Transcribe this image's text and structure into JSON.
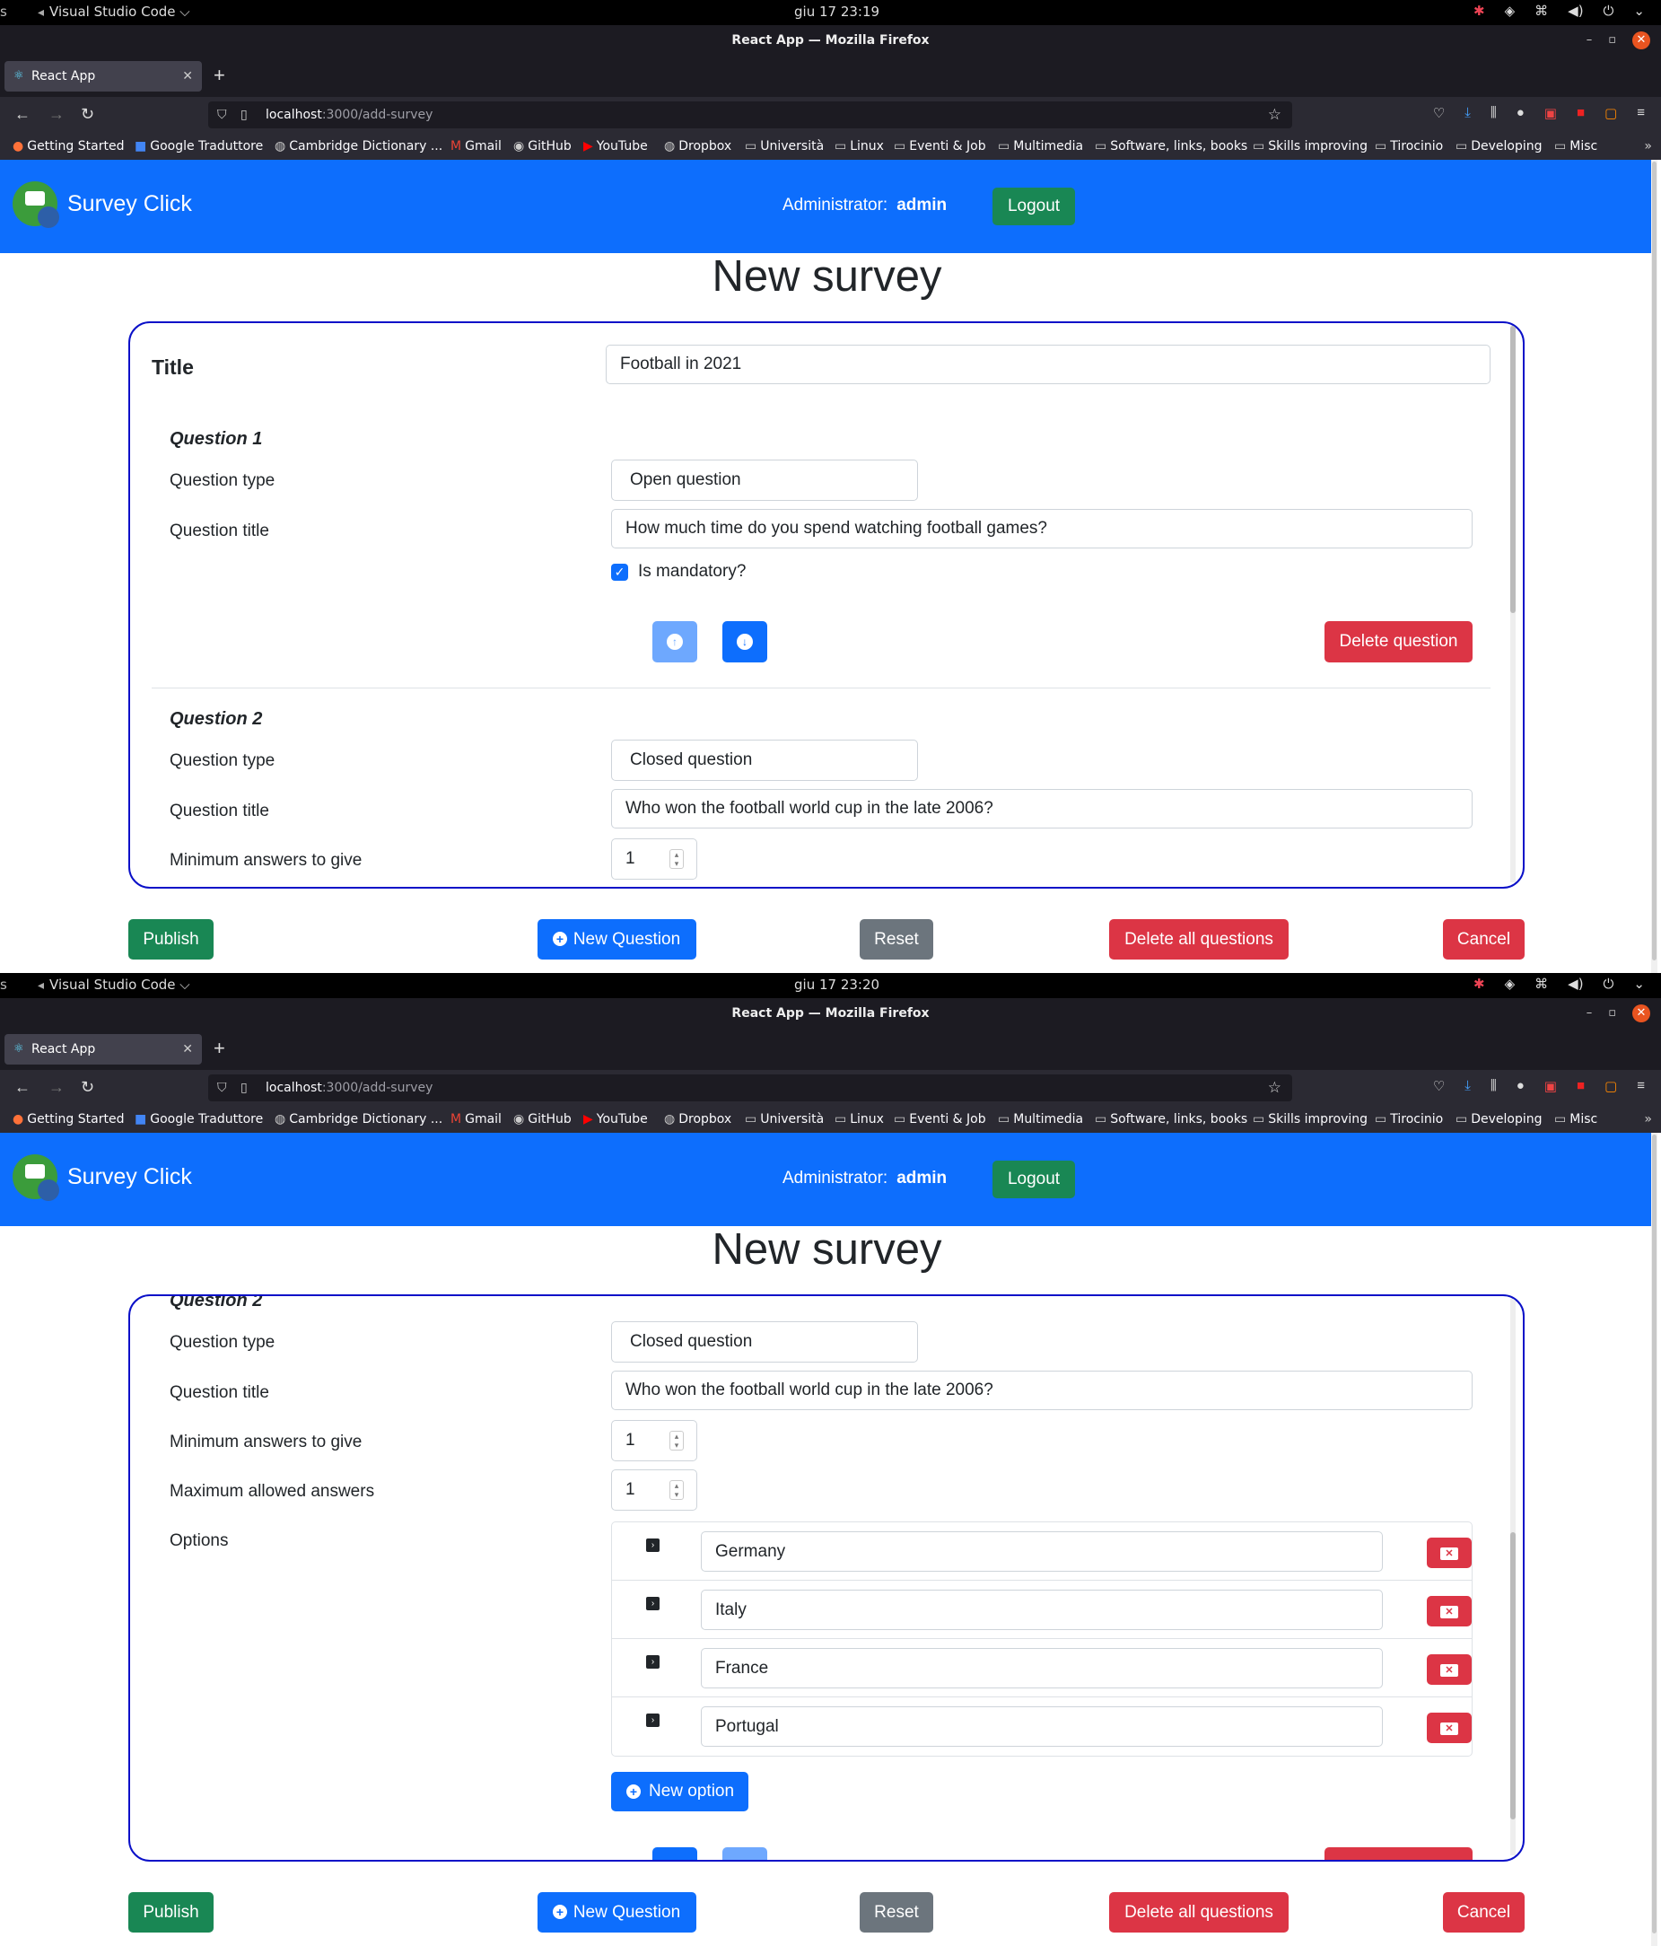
{
  "shots": [
    {
      "topbar": {
        "left": "s",
        "app": "Visual Studio Code ⌵",
        "clock": "giu 17  23:19"
      },
      "window_title": "React App — Mozilla Firefox",
      "tab_title": "React App",
      "url_host": "localhost",
      "url_path": ":3000/add-survey"
    },
    {
      "topbar": {
        "left": "s",
        "app": "Visual Studio Code ⌵",
        "clock": "giu 17  23:20"
      },
      "window_title": "React App — Mozilla Firefox",
      "tab_title": "React App",
      "url_host": "localhost",
      "url_path": ":3000/add-survey"
    }
  ],
  "bookmarks": [
    "Getting Started",
    "Google Traduttore",
    "Cambridge Dictionary ...",
    "Gmail",
    "GitHub",
    "YouTube",
    "Dropbox",
    "Università",
    "Linux",
    "Eventi & Job",
    "Multimedia",
    "Software, links, books",
    "Skills improving",
    "Tirocinio",
    "Developing",
    "Misc"
  ],
  "app": {
    "brand": "Survey Click",
    "admin_label": "Administrator:",
    "admin_name": "admin",
    "logout": "Logout",
    "page_title": "New survey"
  },
  "survey": {
    "title_label": "Title",
    "title_value": "Football in 2021",
    "q1": {
      "heading": "Question 1",
      "type_label": "Question type",
      "type_value": "Open question",
      "title_label": "Question title",
      "title_value": "How much time do you spend watching football games?",
      "mandatory_label": "Is mandatory?",
      "mandatory_checked": true,
      "delete_label": "Delete question"
    },
    "q2": {
      "heading": "Question 2",
      "type_label": "Question type",
      "type_value": "Closed question",
      "title_label": "Question title",
      "title_value": "Who won the football world cup in the late 2006?",
      "min_label": "Minimum answers to give",
      "min_value": "1",
      "max_label": "Maximum allowed answers",
      "max_value": "1",
      "options_label": "Options",
      "options": [
        "Germany",
        "Italy",
        "France",
        "Portugal"
      ],
      "new_option": "New option"
    }
  },
  "actions": {
    "publish": "Publish",
    "new_question": "New Question",
    "reset": "Reset",
    "delete_all": "Delete all questions",
    "cancel": "Cancel"
  },
  "colors": {
    "primary": "#0d6efd",
    "success": "#198754",
    "danger": "#dc3545",
    "secondary": "#6c757d",
    "card_border": "#0a10c8"
  }
}
